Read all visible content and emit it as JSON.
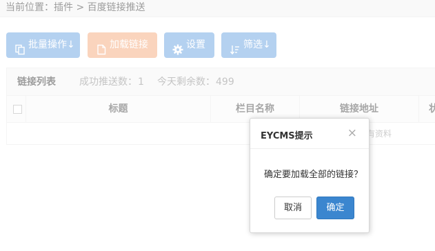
{
  "breadcrumb": {
    "prefix": "当前位置：",
    "item1": "插件",
    "sep": ">",
    "item2": "百度链接推送"
  },
  "toolbar": {
    "batch_label": "批量操作↓",
    "load_label": "加载链接",
    "settings_label": "设置",
    "filter_label": "筛选↓"
  },
  "panel": {
    "title": "链接列表",
    "success_label": "成功推送数：",
    "success_count": "1",
    "remaining_label": "今天剩余数：",
    "remaining_count": "499"
  },
  "table": {
    "columns": [
      "标题",
      "栏目名称",
      "链接地址",
      "状"
    ],
    "empty_text": "有资料"
  },
  "modal": {
    "title": "EYCMS提示",
    "close": "×",
    "message": "确定要加载全部的链接？",
    "cancel_label": "取消",
    "ok_label": "确定"
  },
  "colors": {
    "primary_button": "#7fb0e6",
    "load_button": "#f6b58d",
    "confirm_button": "#3b86cf"
  },
  "icons": [
    "copy-icon",
    "file-icon",
    "gear-icon",
    "sort-icon",
    "close-icon"
  ]
}
